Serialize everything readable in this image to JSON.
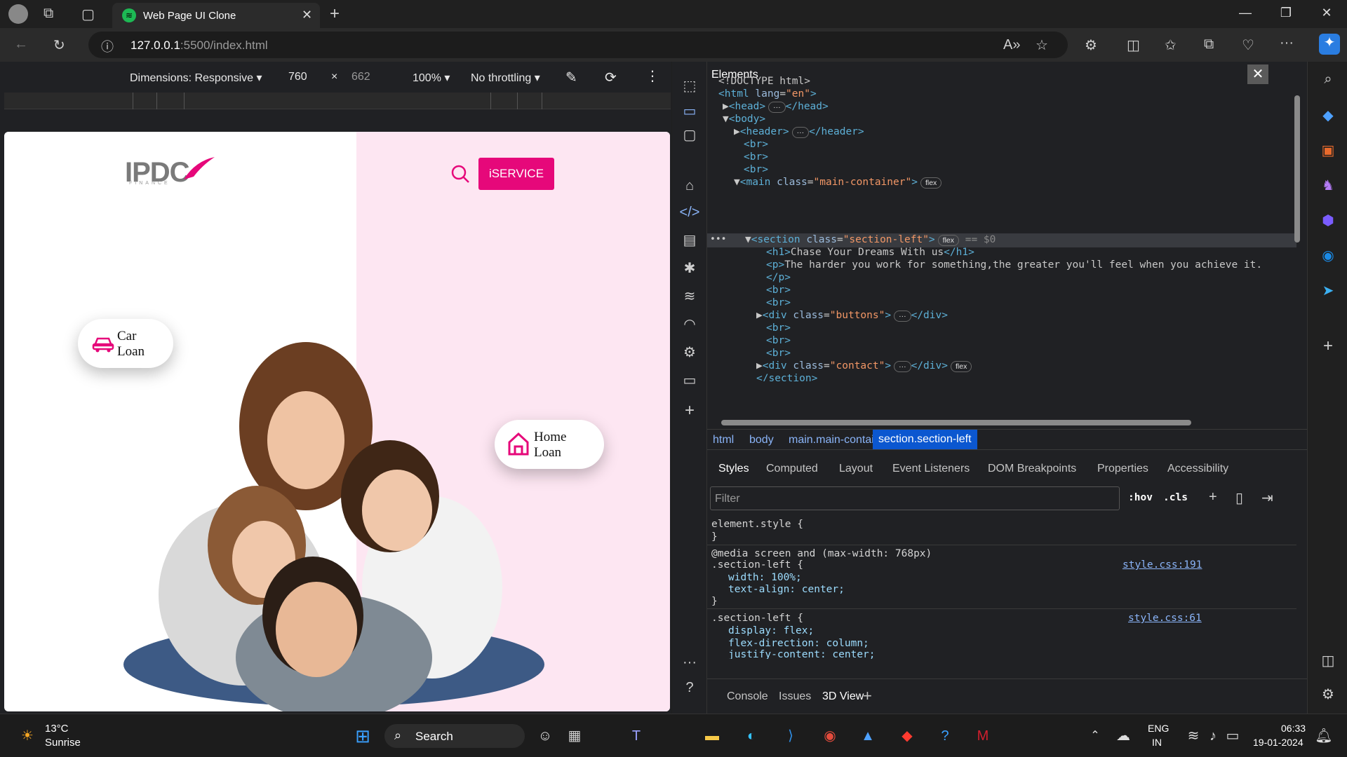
{
  "browser": {
    "tab_title": "Web Page UI Clone",
    "url_host": "127.0.0.1",
    "url_rest": ":5500/index.html"
  },
  "device_toolbar": {
    "dimensions": "Dimensions: Responsive",
    "width": "760",
    "x": "×",
    "height": "662",
    "zoom": "100%",
    "throttling": "No throttling"
  },
  "page": {
    "logo": "IPDC",
    "logo_sub": "FINANCE",
    "iservice": "iSERVICE",
    "car_loan_1": "Car",
    "car_loan_2": "Loan",
    "home_loan_1": "Home",
    "home_loan_2": "Loan"
  },
  "devtools": {
    "panel_title": "Elements",
    "dom": [
      "<!DOCTYPE html>"
    ],
    "breadcrumbs": [
      "html",
      "body",
      "main.main-container",
      "section.section-left"
    ],
    "subtabs": [
      "Styles",
      "Computed",
      "Layout",
      "Event Listeners",
      "DOM Breakpoints",
      "Properties",
      "Accessibility"
    ],
    "filter_placeholder": "Filter",
    "hov": ":hov",
    "cls": ".cls",
    "styles": {
      "element_style": "element.style {",
      "close": "}",
      "media": "@media screen and (max-width: 768px)",
      "rule1_sel": ".section-left {",
      "rule1_p1": "width: 100%;",
      "rule1_p2": "text-align: center;",
      "rule1_link": "style.css:191",
      "rule2_sel": ".section-left {",
      "rule2_p1": "display: flex;",
      "rule2_p2": "flex-direction: column;",
      "rule2_p3": "justify-content: center;",
      "rule2_link": "style.css:61"
    },
    "bottom_tabs": [
      "Console",
      "Issues",
      "3D View"
    ]
  },
  "taskbar": {
    "weather_temp": "13°C",
    "weather_desc": "Sunrise",
    "search": "Search",
    "lang1": "ENG",
    "lang2": "IN",
    "time": "06:33",
    "date": "19-01-2024"
  },
  "colors": {
    "accent_pink": "#e6087a",
    "pink_bg": "#fde6f2"
  }
}
